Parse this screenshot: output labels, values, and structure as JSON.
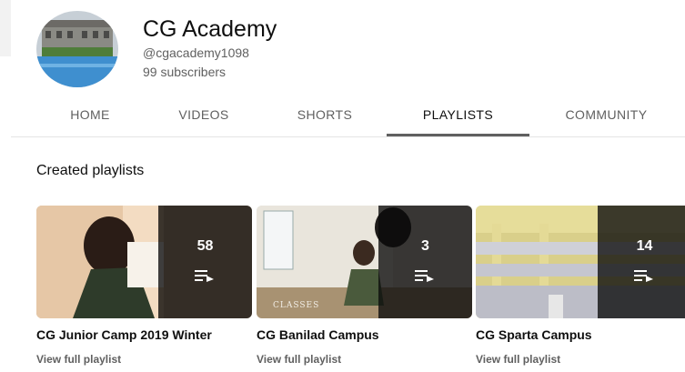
{
  "channel": {
    "name": "CG Academy",
    "handle": "@cgacademy1098",
    "subscribers": "99 subscribers"
  },
  "tabs": [
    {
      "label": "HOME",
      "active": false
    },
    {
      "label": "VIDEOS",
      "active": false
    },
    {
      "label": "SHORTS",
      "active": false
    },
    {
      "label": "PLAYLISTS",
      "active": true
    },
    {
      "label": "COMMUNITY",
      "active": false
    }
  ],
  "section": {
    "title": "Created playlists"
  },
  "playlists": [
    {
      "title": "CG Junior Camp 2019 Winter",
      "count": "58",
      "link": "View full playlist",
      "icon": "playlist-icon"
    },
    {
      "title": "CG Banilad Campus",
      "count": "3",
      "link": "View full playlist",
      "icon": "playlist-icon"
    },
    {
      "title": "CG Sparta Campus",
      "count": "14",
      "link": "View full playlist",
      "icon": "playlist-icon"
    }
  ],
  "colors": {
    "text_primary": "#0f0f0f",
    "text_secondary": "#606060",
    "divider": "#e5e5e5"
  }
}
